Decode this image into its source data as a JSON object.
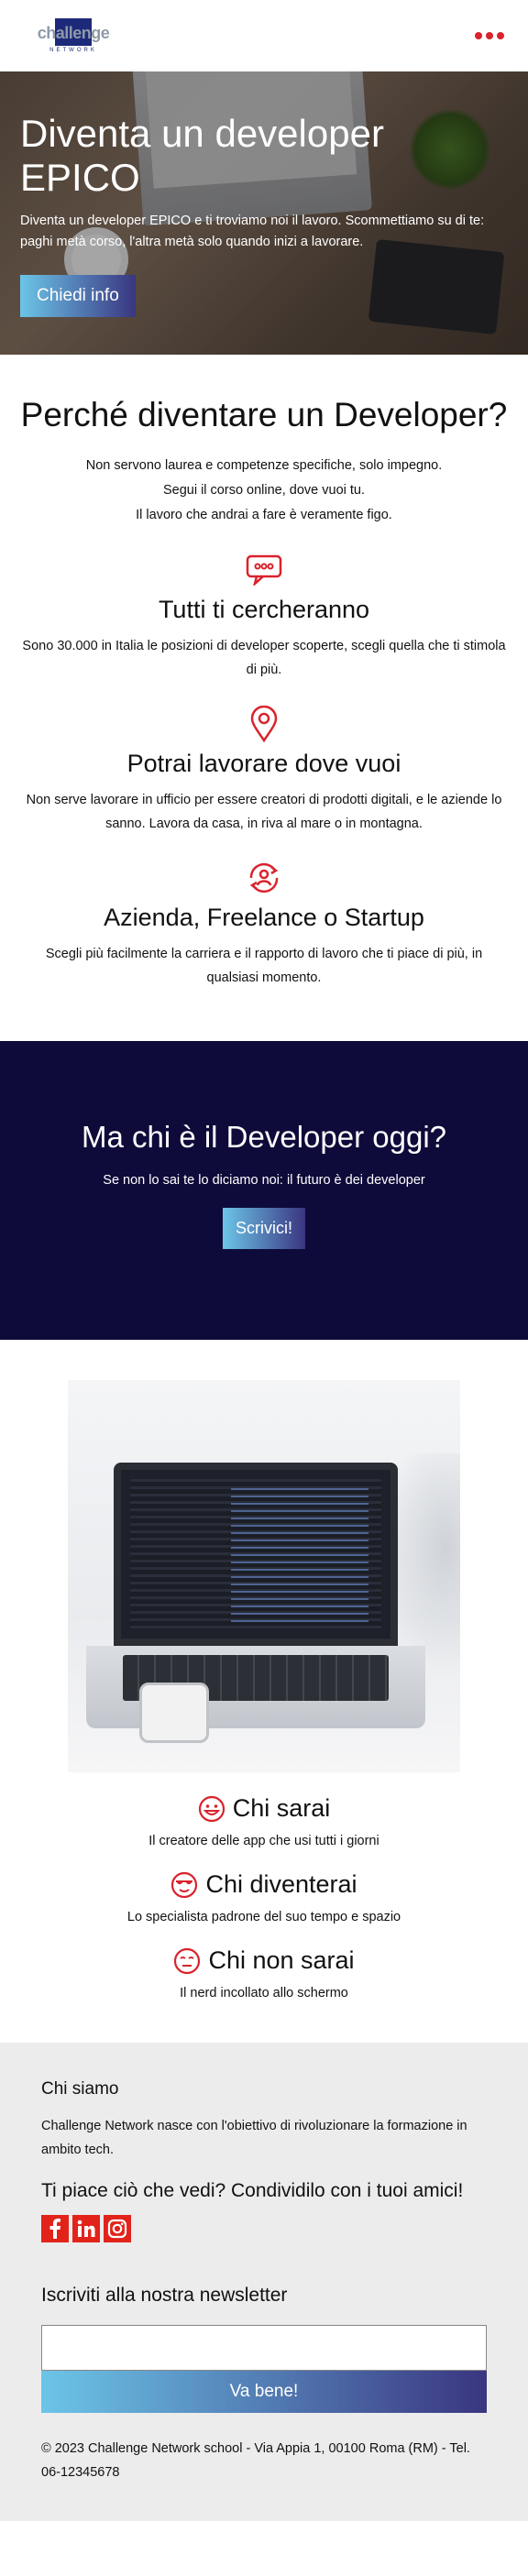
{
  "header": {
    "logo_text": "challenge",
    "logo_sub": "NETWORK"
  },
  "hero": {
    "title": "Diventa un developer EPICO",
    "text": "Diventa un developer EPICO e ti troviamo noi il lavoro. Scommettiamo su di te: paghi metà corso, l'altra metà solo quando inizi a lavorare.",
    "button": "Chiedi info"
  },
  "why": {
    "title": "Perché diventare un Developer?",
    "intro": [
      "Non servono laurea e competenze specifiche, solo impegno.",
      "Segui il corso online, dove vuoi tu.",
      "Il lavoro che andrai a fare è veramente figo."
    ],
    "features": [
      {
        "title": "Tutti ti cercheranno",
        "text": "Sono 30.000 in Italia le posizioni di developer scoperte, scegli quella che ti stimola di più."
      },
      {
        "title": "Potrai lavorare dove vuoi",
        "text": "Non serve lavorare in ufficio per essere creatori di prodotti digitali, e le aziende lo sanno. Lavora da casa, in riva al mare o in montagna."
      },
      {
        "title": "Azienda, Freelance o Startup",
        "text": "Scegli più facilmente la carriera e il rapporto di lavoro che ti piace di più, in qualsiasi momento."
      }
    ]
  },
  "dark": {
    "title": "Ma chi è il Developer oggi?",
    "text": "Se non lo sai te lo diciamo noi: il futuro è dei developer",
    "button": "Scrivici!"
  },
  "roles": [
    {
      "title": "Chi sarai",
      "text": "Il creatore delle app che usi tutti i giorni"
    },
    {
      "title": "Chi diventerai",
      "text": "Lo specialista padrone del suo tempo e spazio"
    },
    {
      "title": "Chi non sarai",
      "text": "Il nerd incollato allo schermo"
    }
  ],
  "footer": {
    "about_title": "Chi siamo",
    "about_text": "Challenge Network nasce con l'obiettivo di rivoluzionare la formazione in ambito tech.",
    "share_title": "Ti piace ciò che vedi? Condividilo con i tuoi amici!",
    "newsletter_title": "Iscriviti alla nostra newsletter",
    "newsletter_value": "",
    "newsletter_button": "Va bene!",
    "copyright": "© 2023 Challenge Network school - Via Appia 1, 00100 Roma (RM) - Tel. 06-12345678"
  },
  "colors": {
    "accent": "#d9232d",
    "dark_bg": "#0e0b3a",
    "gradient_start": "#6cc5e8",
    "gradient_end": "#3a3580",
    "footer_bg": "#ececec"
  },
  "icons": [
    "menu-dots-icon",
    "chat-bubble-icon",
    "map-pin-icon",
    "user-sync-icon",
    "smile-icon",
    "cool-face-icon",
    "neutral-face-icon",
    "facebook-icon",
    "linkedin-icon",
    "instagram-icon"
  ]
}
